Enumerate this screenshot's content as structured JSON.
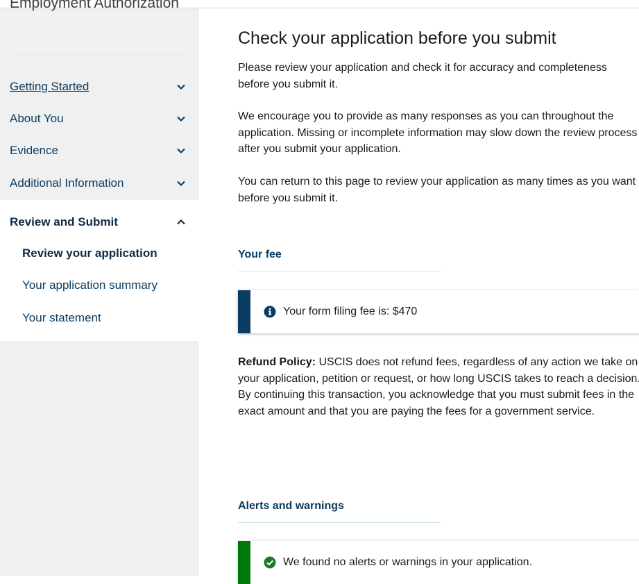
{
  "sidebar": {
    "app_title": "Employment Authorization",
    "sections": [
      {
        "label": "Getting Started",
        "state": "collapsed",
        "icon": "chevron-down-icon"
      },
      {
        "label": "About You",
        "state": "collapsed",
        "icon": "chevron-down-icon"
      },
      {
        "label": "Evidence",
        "state": "collapsed",
        "icon": "chevron-down-icon"
      },
      {
        "label": "Additional Information",
        "state": "collapsed",
        "icon": "chevron-down-icon"
      },
      {
        "label": "Review and Submit",
        "state": "expanded",
        "icon": "chevron-up-icon"
      }
    ],
    "subitems": [
      {
        "label": "Review your application",
        "current": true
      },
      {
        "label": "Your application summary",
        "current": false
      },
      {
        "label": "Your statement",
        "current": false
      }
    ]
  },
  "main": {
    "title": "Check your application before you submit",
    "paragraphs": [
      "Please review your application and check it for accuracy and completeness before you submit it.",
      "We encourage you to provide as many responses as you can throughout the application. Missing or incomplete information may slow down the review process after you submit your application.",
      "You can return to this page to review your application as many times as you want before you submit it."
    ],
    "fee": {
      "heading": "Your fee",
      "alert_text": "Your form filing fee is: $470",
      "alert_icon": "info-icon"
    },
    "refund": {
      "label": "Refund Policy:",
      "text": " USCIS does not refund fees, regardless of any action we take on your application, petition or request, or how long USCIS takes to reach a decision. By continuing this transaction, you acknowledge that you must submit fees in the exact amount and that you are paying the fees for a government service."
    },
    "alerts": {
      "heading": "Alerts and warnings",
      "alert_text": "We found no alerts or warnings in your application.",
      "alert_icon": "check-circle-icon"
    }
  },
  "colors": {
    "sidebar_bg": "#f0f0f0",
    "link": "#0b3c61",
    "info_bar": "#0b3c61",
    "success_bar": "#00790a",
    "success_icon": "#00790a",
    "info_icon": "#0b3c61"
  }
}
